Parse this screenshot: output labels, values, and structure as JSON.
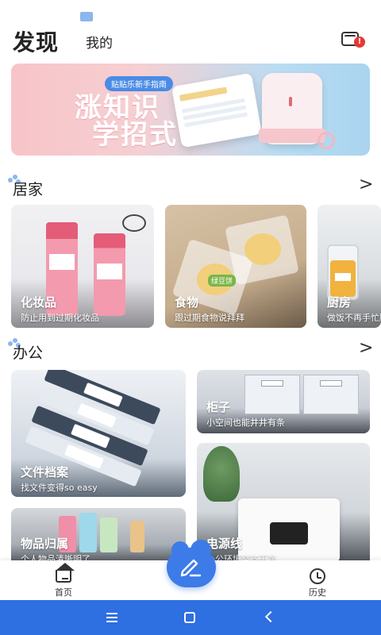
{
  "header": {
    "tab_discover": "发现",
    "tab_mine": "我的",
    "message_badge": "!"
  },
  "banner": {
    "pill": "贴贴乐新手指南",
    "line1": "涨知识",
    "line2": "学招式"
  },
  "sections": {
    "home": {
      "title": "居家",
      "arrow": ">",
      "cards": [
        {
          "name": "化妆品",
          "desc": "防止用到过期化妆品"
        },
        {
          "name": "食物",
          "desc": "跟过期食物说拜拜",
          "food_tag": "绿豆饼"
        },
        {
          "name": "厨房",
          "desc": "做饭不再手忙脚乱"
        }
      ]
    },
    "office": {
      "title": "办公",
      "arrow": ">",
      "cards": [
        {
          "name": "文件档案",
          "desc": "找文件变得so easy"
        },
        {
          "name": "柜子",
          "desc": "小空间也能井井有条"
        },
        {
          "name": "电源线",
          "desc": "办公环境整齐干净"
        },
        {
          "name": "物品归属",
          "desc": "个人物品清晰明了"
        }
      ]
    }
  },
  "bottom_nav": {
    "home": "首页",
    "history": "历史"
  },
  "colors": {
    "accent": "#3d7be8",
    "system_bar": "#2e6fe2",
    "badge": "#e53935"
  }
}
